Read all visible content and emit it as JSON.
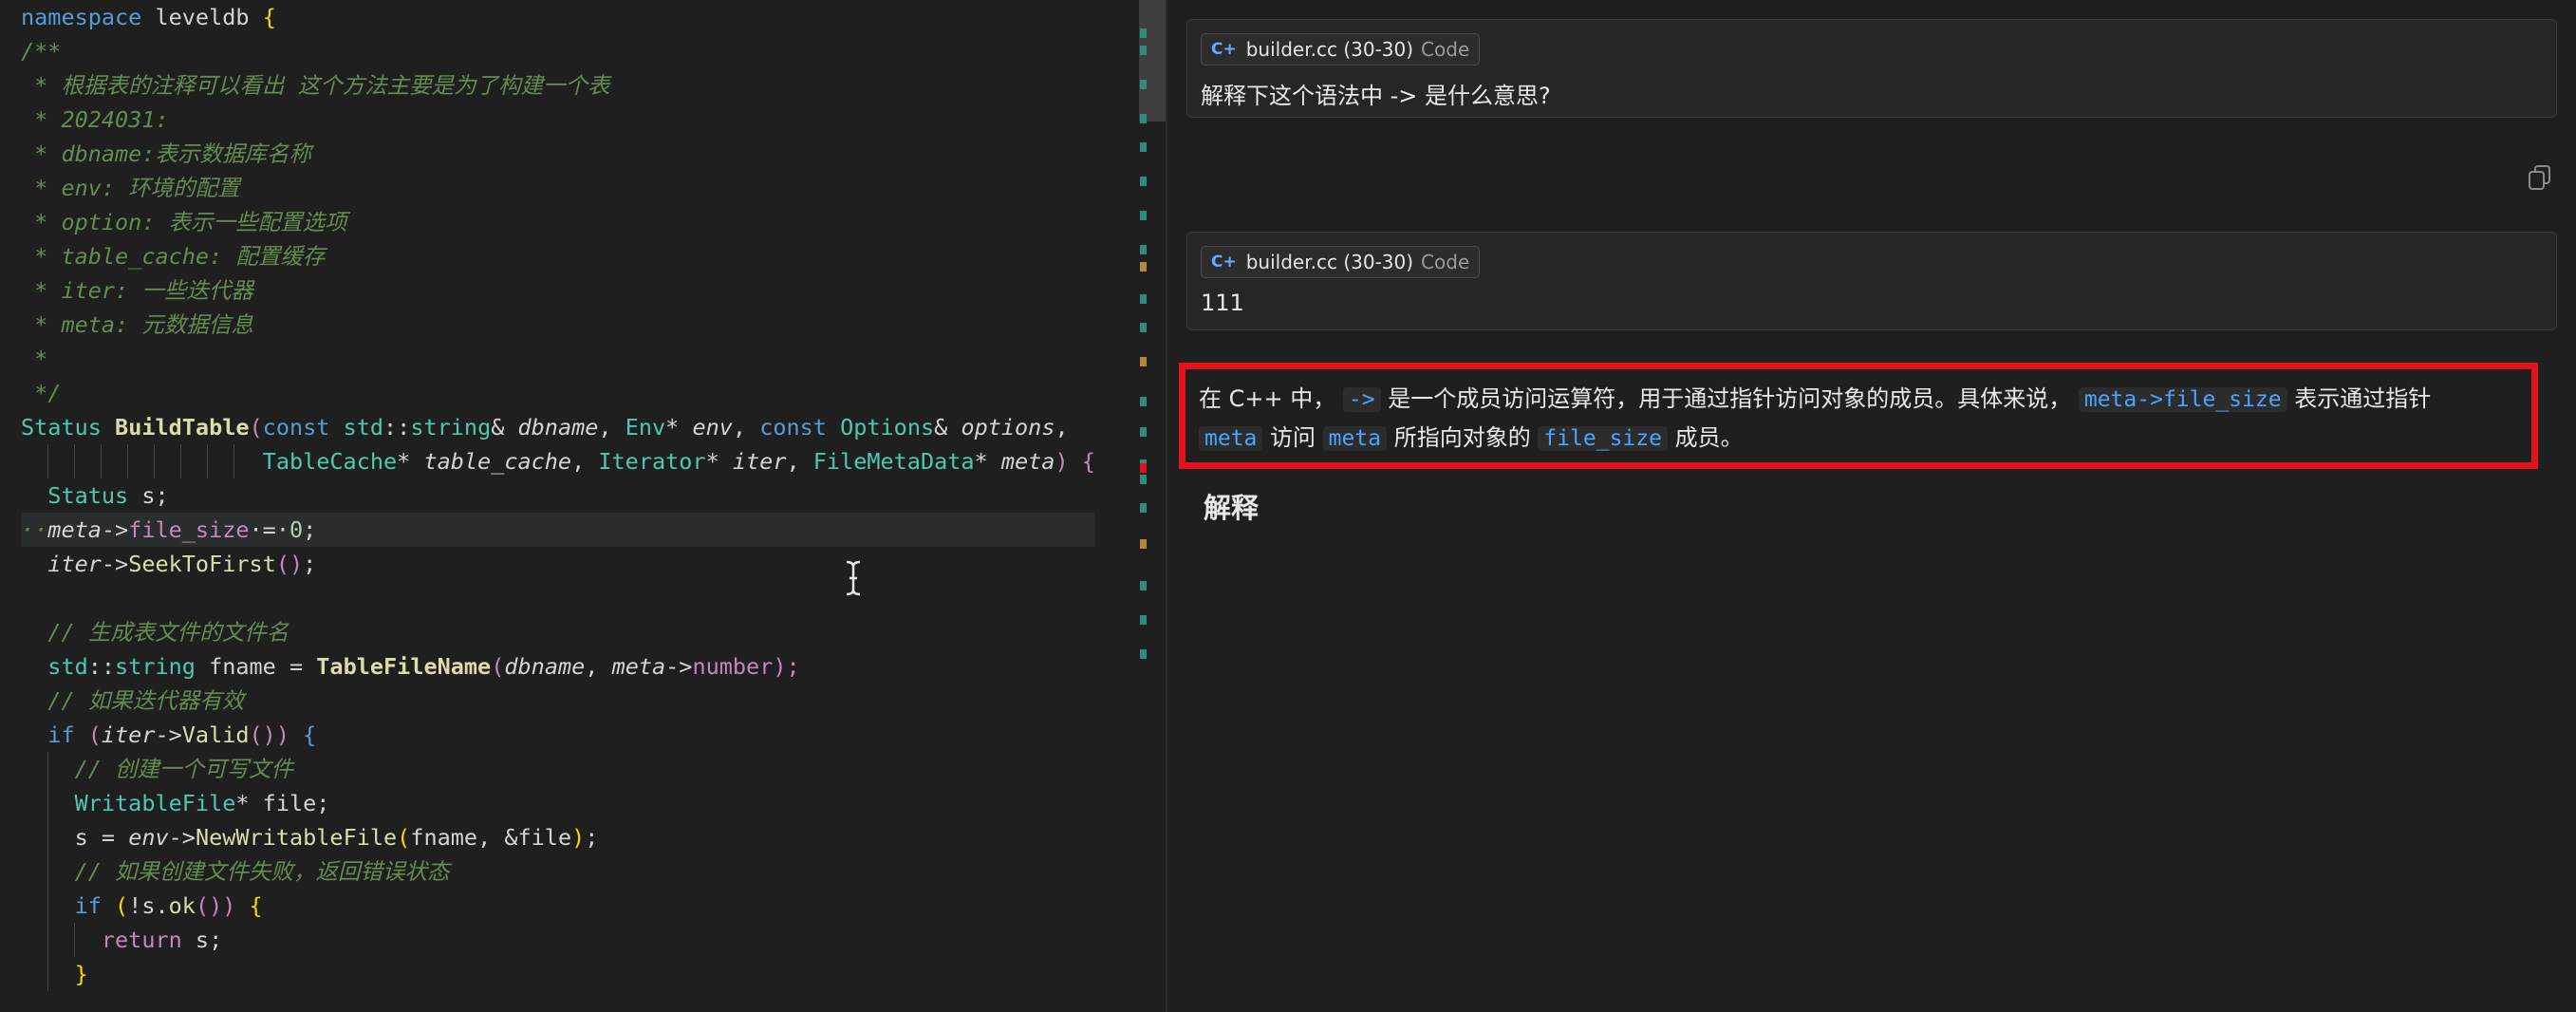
{
  "editor": {
    "lines": [
      [
        {
          "t": "namespace",
          "c": "ns"
        },
        {
          "t": " leveldb ",
          "c": "plain"
        },
        {
          "t": "{",
          "c": "brace"
        }
      ],
      [
        {
          "t": "/**",
          "c": "comment"
        }
      ],
      [
        {
          "t": " * 根据表的注释可以看出 这个方法主要是为了构建一个表",
          "c": "comment"
        }
      ],
      [
        {
          "t": " * 2024031:",
          "c": "comment"
        }
      ],
      [
        {
          "t": " * dbname:表示数据库名称",
          "c": "comment"
        }
      ],
      [
        {
          "t": " * env: 环境的配置",
          "c": "comment"
        }
      ],
      [
        {
          "t": " * option: 表示一些配置选项",
          "c": "comment"
        }
      ],
      [
        {
          "t": " * table_cache: 配置缓存",
          "c": "comment"
        }
      ],
      [
        {
          "t": " * iter: 一些迭代器",
          "c": "comment"
        }
      ],
      [
        {
          "t": " * meta: 元数据信息",
          "c": "comment"
        }
      ],
      [
        {
          "t": " *",
          "c": "comment"
        }
      ],
      [
        {
          "t": " */",
          "c": "comment"
        }
      ],
      [
        {
          "t": "Status ",
          "c": "type"
        },
        {
          "t": "BuildTable",
          "c": "func"
        },
        {
          "t": "(",
          "c": "ctrl"
        },
        {
          "t": "const ",
          "c": "kw"
        },
        {
          "t": "std",
          "c": "type"
        },
        {
          "t": "::",
          "c": "plain"
        },
        {
          "t": "string",
          "c": "type"
        },
        {
          "t": "& ",
          "c": "plain"
        },
        {
          "t": "dbname",
          "c": "param"
        },
        {
          "t": ", ",
          "c": "plain"
        },
        {
          "t": "Env",
          "c": "type"
        },
        {
          "t": "* ",
          "c": "plain"
        },
        {
          "t": "env",
          "c": "param"
        },
        {
          "t": ", ",
          "c": "plain"
        },
        {
          "t": "const ",
          "c": "kw"
        },
        {
          "t": "Options",
          "c": "type"
        },
        {
          "t": "& ",
          "c": "plain"
        },
        {
          "t": "options",
          "c": "param"
        },
        {
          "t": ",",
          "c": "plain"
        }
      ],
      [
        {
          "t": "                  ",
          "c": "plain"
        },
        {
          "t": "TableCache",
          "c": "type"
        },
        {
          "t": "* ",
          "c": "plain"
        },
        {
          "t": "table_cache",
          "c": "param"
        },
        {
          "t": ", ",
          "c": "plain"
        },
        {
          "t": "Iterator",
          "c": "type"
        },
        {
          "t": "* ",
          "c": "plain"
        },
        {
          "t": "iter",
          "c": "param"
        },
        {
          "t": ", ",
          "c": "plain"
        },
        {
          "t": "FileMetaData",
          "c": "type"
        },
        {
          "t": "* ",
          "c": "plain"
        },
        {
          "t": "meta",
          "c": "param"
        },
        {
          "t": ") ",
          "c": "ctrl"
        },
        {
          "t": "{",
          "c": "ctrl"
        }
      ],
      [
        {
          "t": "  ",
          "c": "plain"
        },
        {
          "t": "Status",
          "c": "type"
        },
        {
          "t": " s;",
          "c": "plain"
        }
      ],
      [
        {
          "t": "··",
          "c": "comment"
        },
        {
          "t": "meta",
          "c": "param"
        },
        {
          "t": "->",
          "c": "plain"
        },
        {
          "t": "file_size",
          "c": "field"
        },
        {
          "t": "·=·",
          "c": "plain"
        },
        {
          "t": "0",
          "c": "num"
        },
        {
          "t": ";",
          "c": "plain"
        }
      ],
      [
        {
          "t": "  ",
          "c": "plain"
        },
        {
          "t": "iter",
          "c": "param"
        },
        {
          "t": "->",
          "c": "plain"
        },
        {
          "t": "SeekToFirst",
          "c": "call"
        },
        {
          "t": "()",
          "c": "ctrl"
        },
        {
          "t": ";",
          "c": "plain"
        }
      ],
      [
        {
          "t": "",
          "c": "plain"
        }
      ],
      [
        {
          "t": "  // 生成表文件的文件名",
          "c": "comment"
        }
      ],
      [
        {
          "t": "  ",
          "c": "plain"
        },
        {
          "t": "std",
          "c": "type"
        },
        {
          "t": "::",
          "c": "plain"
        },
        {
          "t": "string",
          "c": "type"
        },
        {
          "t": " fname = ",
          "c": "plain"
        },
        {
          "t": "TableFileName",
          "c": "func"
        },
        {
          "t": "(",
          "c": "ctrl"
        },
        {
          "t": "dbname",
          "c": "param"
        },
        {
          "t": ", ",
          "c": "plain"
        },
        {
          "t": "meta",
          "c": "param"
        },
        {
          "t": "->",
          "c": "plain"
        },
        {
          "t": "number",
          "c": "field"
        },
        {
          "t": ");",
          "c": "ctrl"
        }
      ],
      [
        {
          "t": "  // 如果迭代器有效",
          "c": "comment"
        }
      ],
      [
        {
          "t": "  ",
          "c": "plain"
        },
        {
          "t": "if",
          "c": "kw"
        },
        {
          "t": " (",
          "c": "ctrl"
        },
        {
          "t": "iter",
          "c": "param"
        },
        {
          "t": "->",
          "c": "plain"
        },
        {
          "t": "Valid",
          "c": "call"
        },
        {
          "t": "()) ",
          "c": "ctrl"
        },
        {
          "t": "{",
          "c": "kw"
        }
      ],
      [
        {
          "t": "    // 创建一个可写文件",
          "c": "comment"
        }
      ],
      [
        {
          "t": "    ",
          "c": "plain"
        },
        {
          "t": "WritableFile",
          "c": "type"
        },
        {
          "t": "* file;",
          "c": "plain"
        }
      ],
      [
        {
          "t": "    s = ",
          "c": "plain"
        },
        {
          "t": "env",
          "c": "param"
        },
        {
          "t": "->",
          "c": "plain"
        },
        {
          "t": "NewWritableFile",
          "c": "call"
        },
        {
          "t": "(",
          "c": "brace"
        },
        {
          "t": "fname, &file",
          "c": "plain"
        },
        {
          "t": ")",
          "c": "brace"
        },
        {
          "t": ";",
          "c": "plain"
        }
      ],
      [
        {
          "t": "    // 如果创建文件失败，返回错误状态",
          "c": "comment"
        }
      ],
      [
        {
          "t": "    ",
          "c": "plain"
        },
        {
          "t": "if",
          "c": "kw"
        },
        {
          "t": " (",
          "c": "brace"
        },
        {
          "t": "!s.",
          "c": "plain"
        },
        {
          "t": "ok",
          "c": "call"
        },
        {
          "t": "()) ",
          "c": "ctrl"
        },
        {
          "t": "{",
          "c": "brace"
        }
      ],
      [
        {
          "t": "      ",
          "c": "plain"
        },
        {
          "t": "return",
          "c": "ctrl"
        },
        {
          "t": " s;",
          "c": "plain"
        }
      ],
      [
        {
          "t": "    ",
          "c": "plain"
        },
        {
          "t": "}",
          "c": "brace"
        }
      ]
    ]
  },
  "chat": {
    "messages": [
      {
        "file": "builder.cc (30-30)",
        "kind": "Code",
        "text": "解释下这个语法中 -> 是什么意思?"
      },
      {
        "file": "builder.cc (30-30)",
        "kind": "Code",
        "text": "111"
      }
    ],
    "answer": {
      "line1": [
        {
          "t": "在 C++ 中，",
          "code": false
        },
        {
          "t": "->",
          "code": true
        },
        {
          "t": "是一个成员访问运算符，用于通过指针访问对象的成员。具体来说，",
          "code": false
        },
        {
          "t": "meta->file_size",
          "code": true
        },
        {
          "t": "表示通过指针",
          "code": false
        }
      ],
      "line2": [
        {
          "t": "meta",
          "code": true
        },
        {
          "t": "访问",
          "code": false
        },
        {
          "t": "meta",
          "code": true
        },
        {
          "t": "所指向对象的",
          "code": false
        },
        {
          "t": "file_size",
          "code": true
        },
        {
          "t": "成员。",
          "code": false
        }
      ]
    },
    "heading": "解释"
  },
  "colors": {
    "highlight_border": "#e3131b",
    "inline_code": "#4aa3ff"
  }
}
